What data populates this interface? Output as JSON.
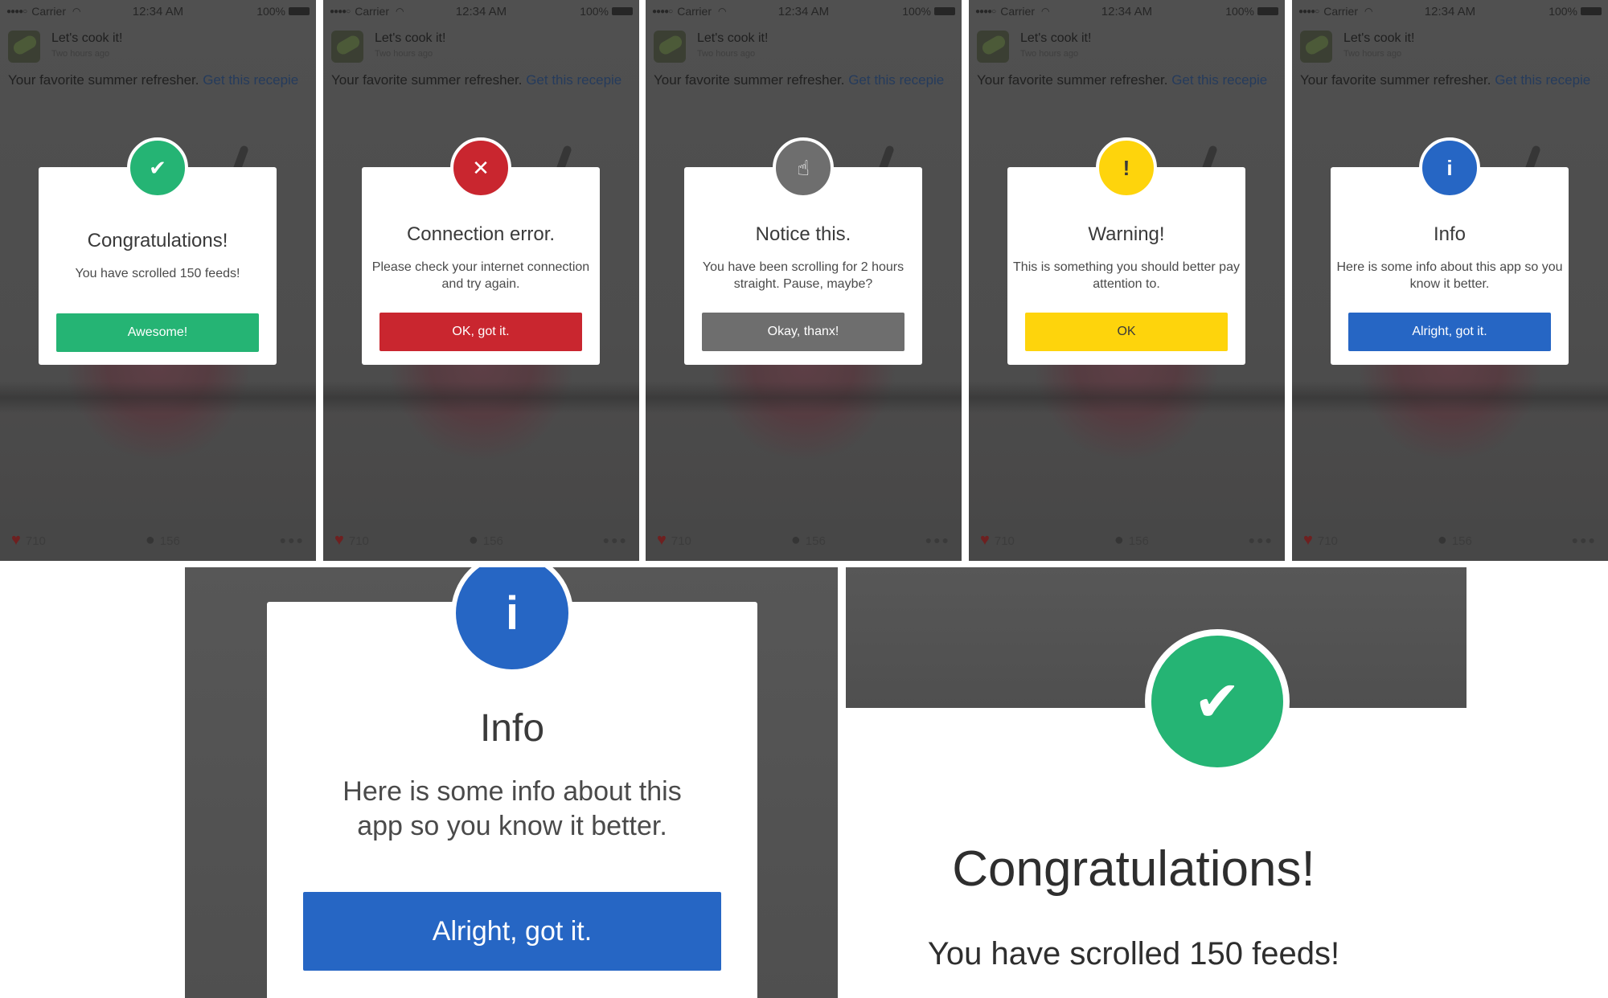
{
  "status_bar": {
    "signal": "●●●●○",
    "carrier": "Carrier",
    "time": "12:34 AM",
    "battery": "100%"
  },
  "post": {
    "title": "Let's cook it!",
    "time": "Two hours ago",
    "caption": "Your favorite summer refresher.",
    "link": "Get this recepie",
    "likes": "710",
    "comments": "156"
  },
  "alerts": [
    {
      "type": "success",
      "color": "#25b474",
      "icon": "check-icon",
      "glyph": "✔",
      "title": "Congratulations!",
      "message": "You have scrolled 150 feeds!",
      "button": "Awesome!"
    },
    {
      "type": "error",
      "color": "#c9262f",
      "icon": "cross-icon",
      "glyph": "✕",
      "title": "Connection error.",
      "message": "Please check your internet connection and try again.",
      "button": "OK, got it."
    },
    {
      "type": "notice",
      "color": "#6e6e6e",
      "icon": "pointer-hand-icon",
      "glyph": "☝",
      "title": "Notice this.",
      "message": "You have been scrolling for 2 hours straight. Pause, maybe?",
      "button": "Okay, thanx!"
    },
    {
      "type": "warning",
      "color": "#fed40c",
      "icon": "exclamation-icon",
      "glyph": "!",
      "title": "Warning!",
      "message": "This is something you should better pay attention to.",
      "button": "OK"
    },
    {
      "type": "info",
      "color": "#2666c4",
      "icon": "info-icon",
      "glyph": "i",
      "title": "Info",
      "message": "Here is some info about this app so you know it better.",
      "button": "Alright, got it."
    }
  ],
  "zoom_info": {
    "glyph": "i",
    "title": "Info",
    "line1": "Here is some info about this",
    "line2": "app so you know it better.",
    "button": "Alright, got it."
  },
  "zoom_success": {
    "glyph": "✔",
    "title": "Congratulations!",
    "message": "You have scrolled 150 feeds!"
  }
}
